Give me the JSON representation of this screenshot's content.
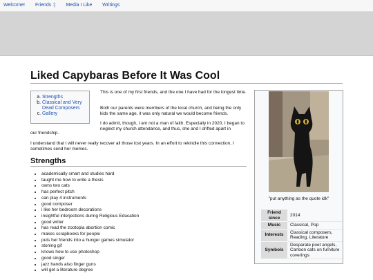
{
  "nav": {
    "items": [
      {
        "label": "Welcome!"
      },
      {
        "label": "Friends :)"
      },
      {
        "label": "Media I Like"
      },
      {
        "label": "Writings"
      }
    ]
  },
  "page": {
    "title": "Liked Capybaras Before It Was Cool"
  },
  "toc": {
    "items": [
      {
        "label": "Strengths"
      },
      {
        "label": "Classical and Very Dead Composers"
      },
      {
        "label": "Gallery"
      }
    ]
  },
  "body": {
    "p1": "This is one of my first friends, and the one I have had for the longest time.",
    "p2": "Both our parents were members of the local church, and being the only kids the same age, it was only natural we would become friends.",
    "p3": "I do admit, though, I am not a man of faith. Especially in 2020, I began to neglect my church attendance, and thus, she and I drifted apart in",
    "p3b": "our friendship.",
    "p4": "I understand that I will never really recover all those lost years. In an effort to rekindle this connection, I sometimes send her memes."
  },
  "strengths": {
    "heading": "Strengths",
    "items": [
      "academically smart and studies hard",
      "taught me how to write a thesis",
      "owns two cats",
      "has perfect pitch",
      "can play 4 instruments",
      "good composer",
      "i like her bedroom decorations",
      "insightful interjections during Religious Education",
      "good writer",
      "has read the zootopia abortion comic",
      "makes scrapbooks for people",
      "puts her friends into a hunger games simulator",
      "stoning gif",
      "knows how to use photoshop",
      "good singer",
      "jazz hands also finger guns",
      "will get a literature degree"
    ]
  },
  "infobox": {
    "image_subject": "black cat standing on a floor",
    "caption": "\"put anything as the quote idk\"",
    "rows": [
      {
        "label": "Friend since",
        "value": "2014"
      },
      {
        "label": "Music",
        "value": "Classical, Pop"
      },
      {
        "label": "Interests",
        "value": "Classical composers, Reading, Literature"
      },
      {
        "label": "Symbols",
        "value": "Desparate poet angels, Cartoon cats on furniture coverings"
      }
    ]
  }
}
